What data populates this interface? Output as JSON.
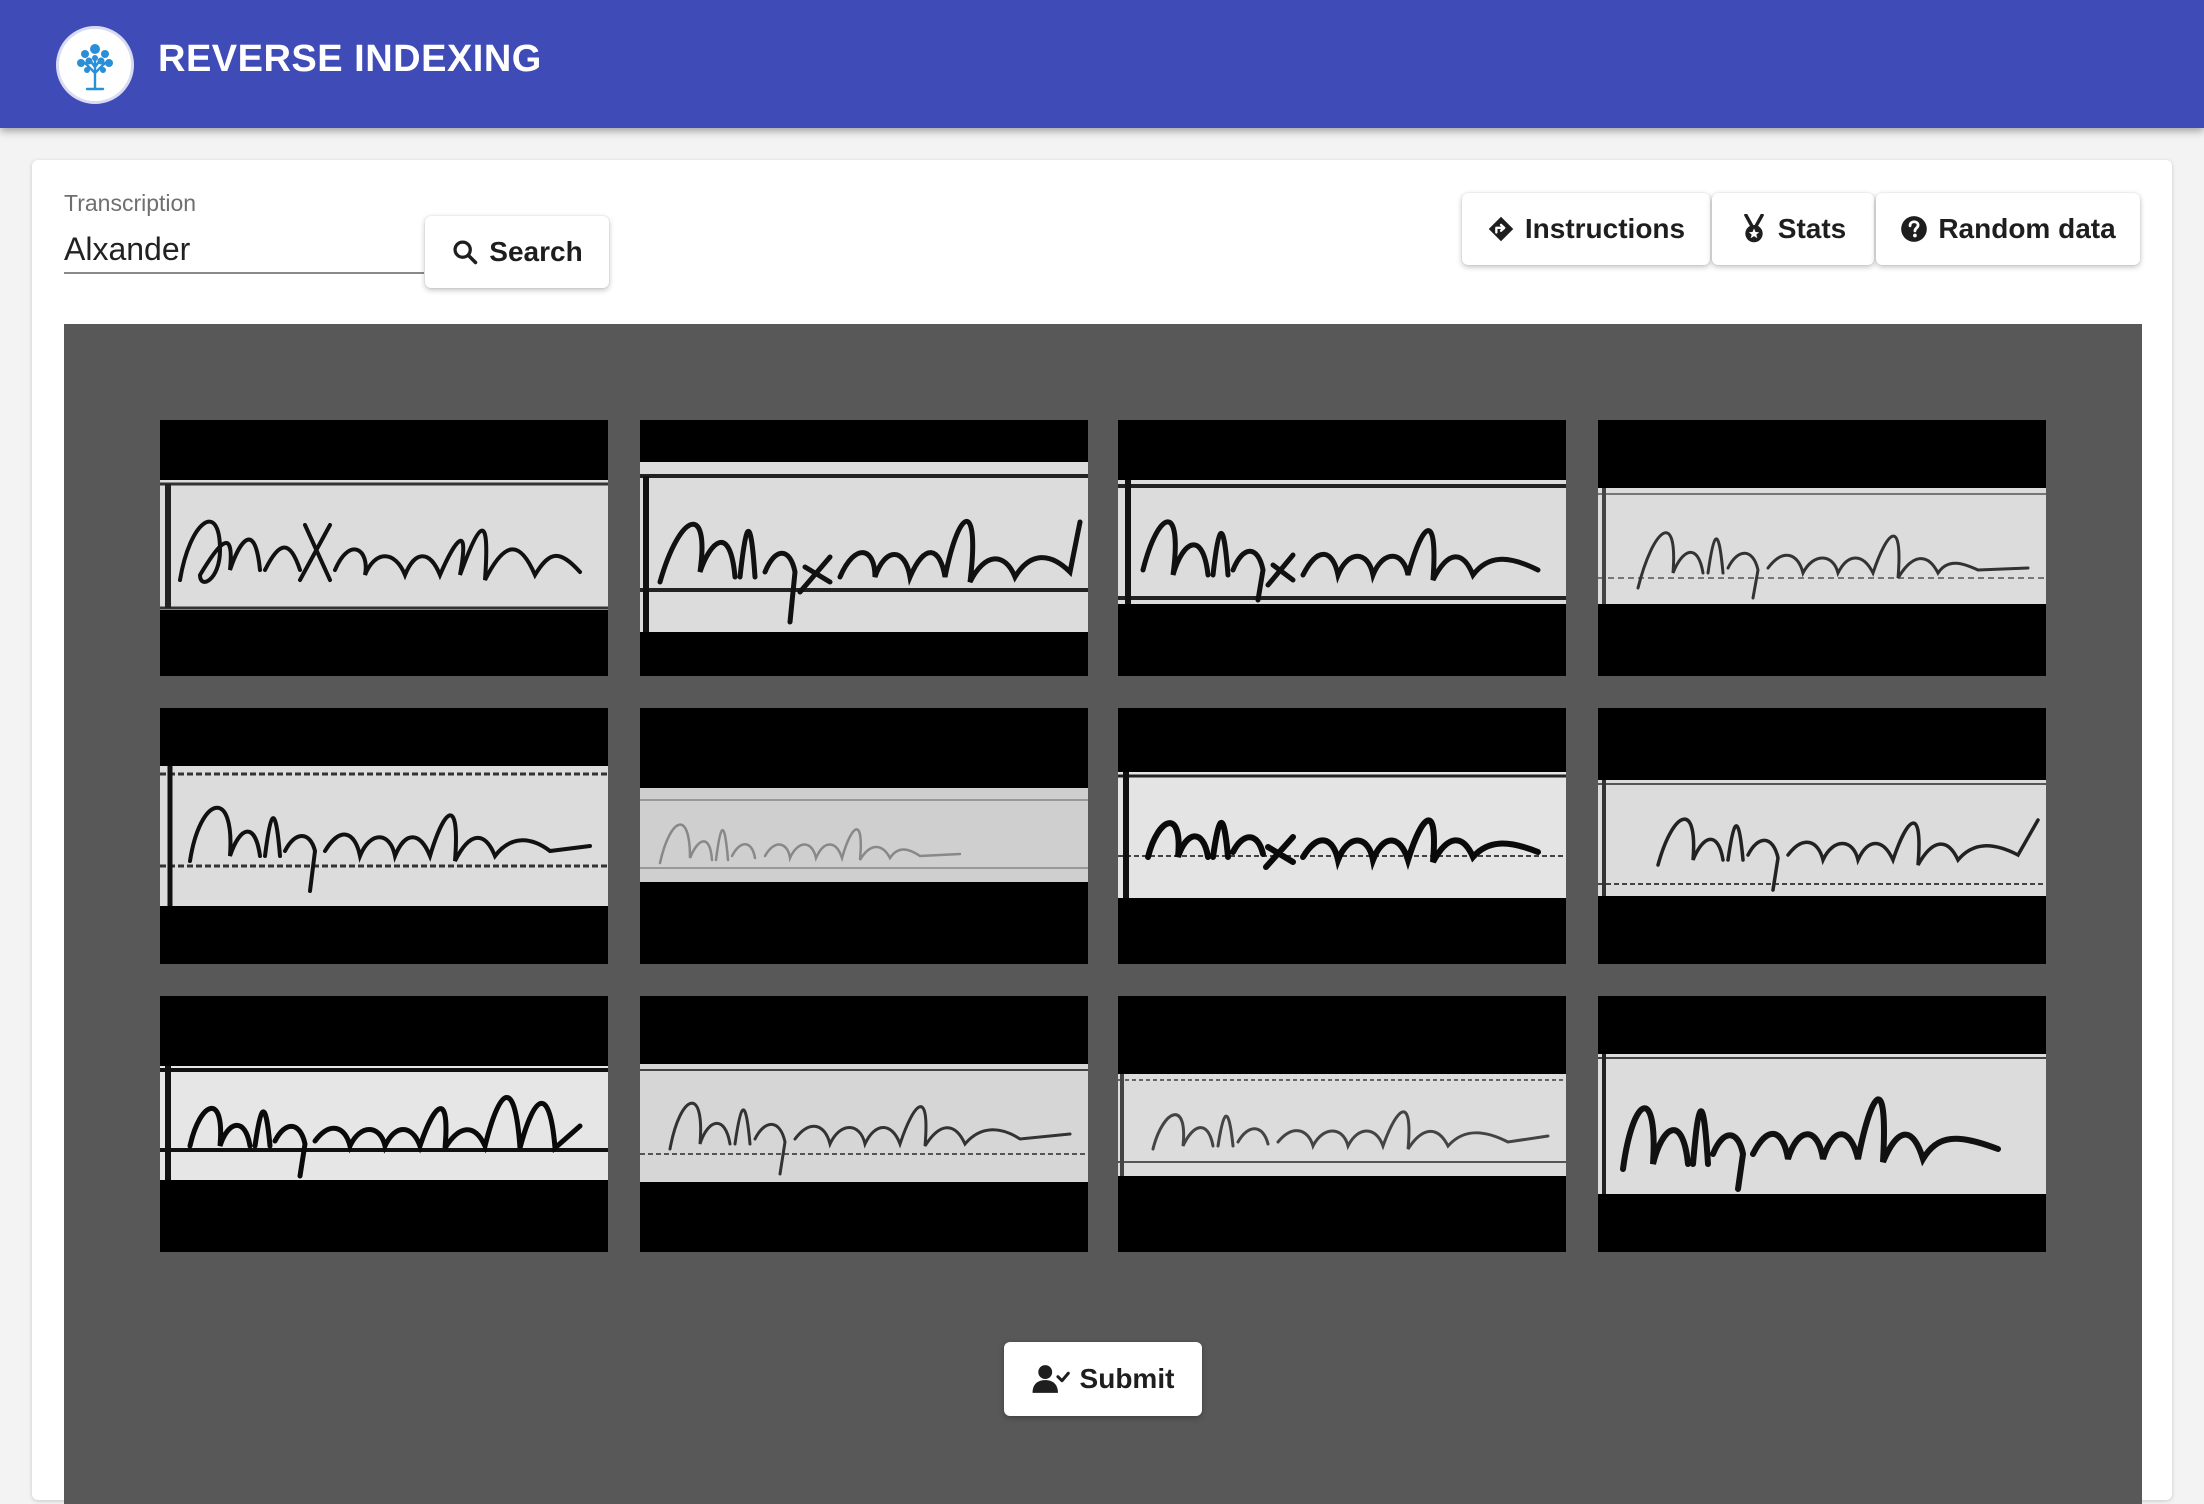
{
  "header": {
    "title": "REVERSE INDEXING",
    "logo_icon": "tree-icon"
  },
  "search": {
    "label": "Transcription",
    "value": "Alxander",
    "button_label": "Search",
    "button_icon": "search-icon"
  },
  "toolbar": {
    "instructions_label": "Instructions",
    "instructions_icon": "directions-icon",
    "stats_label": "Stats",
    "stats_icon": "medal-icon",
    "random_label": "Random data",
    "random_icon": "help-circle-icon"
  },
  "submit": {
    "label": "Submit",
    "icon": "user-check-icon"
  },
  "colors": {
    "appbar": "#3f4bb6",
    "gallery_bg": "#585858",
    "card_bg": "#ffffff"
  }
}
